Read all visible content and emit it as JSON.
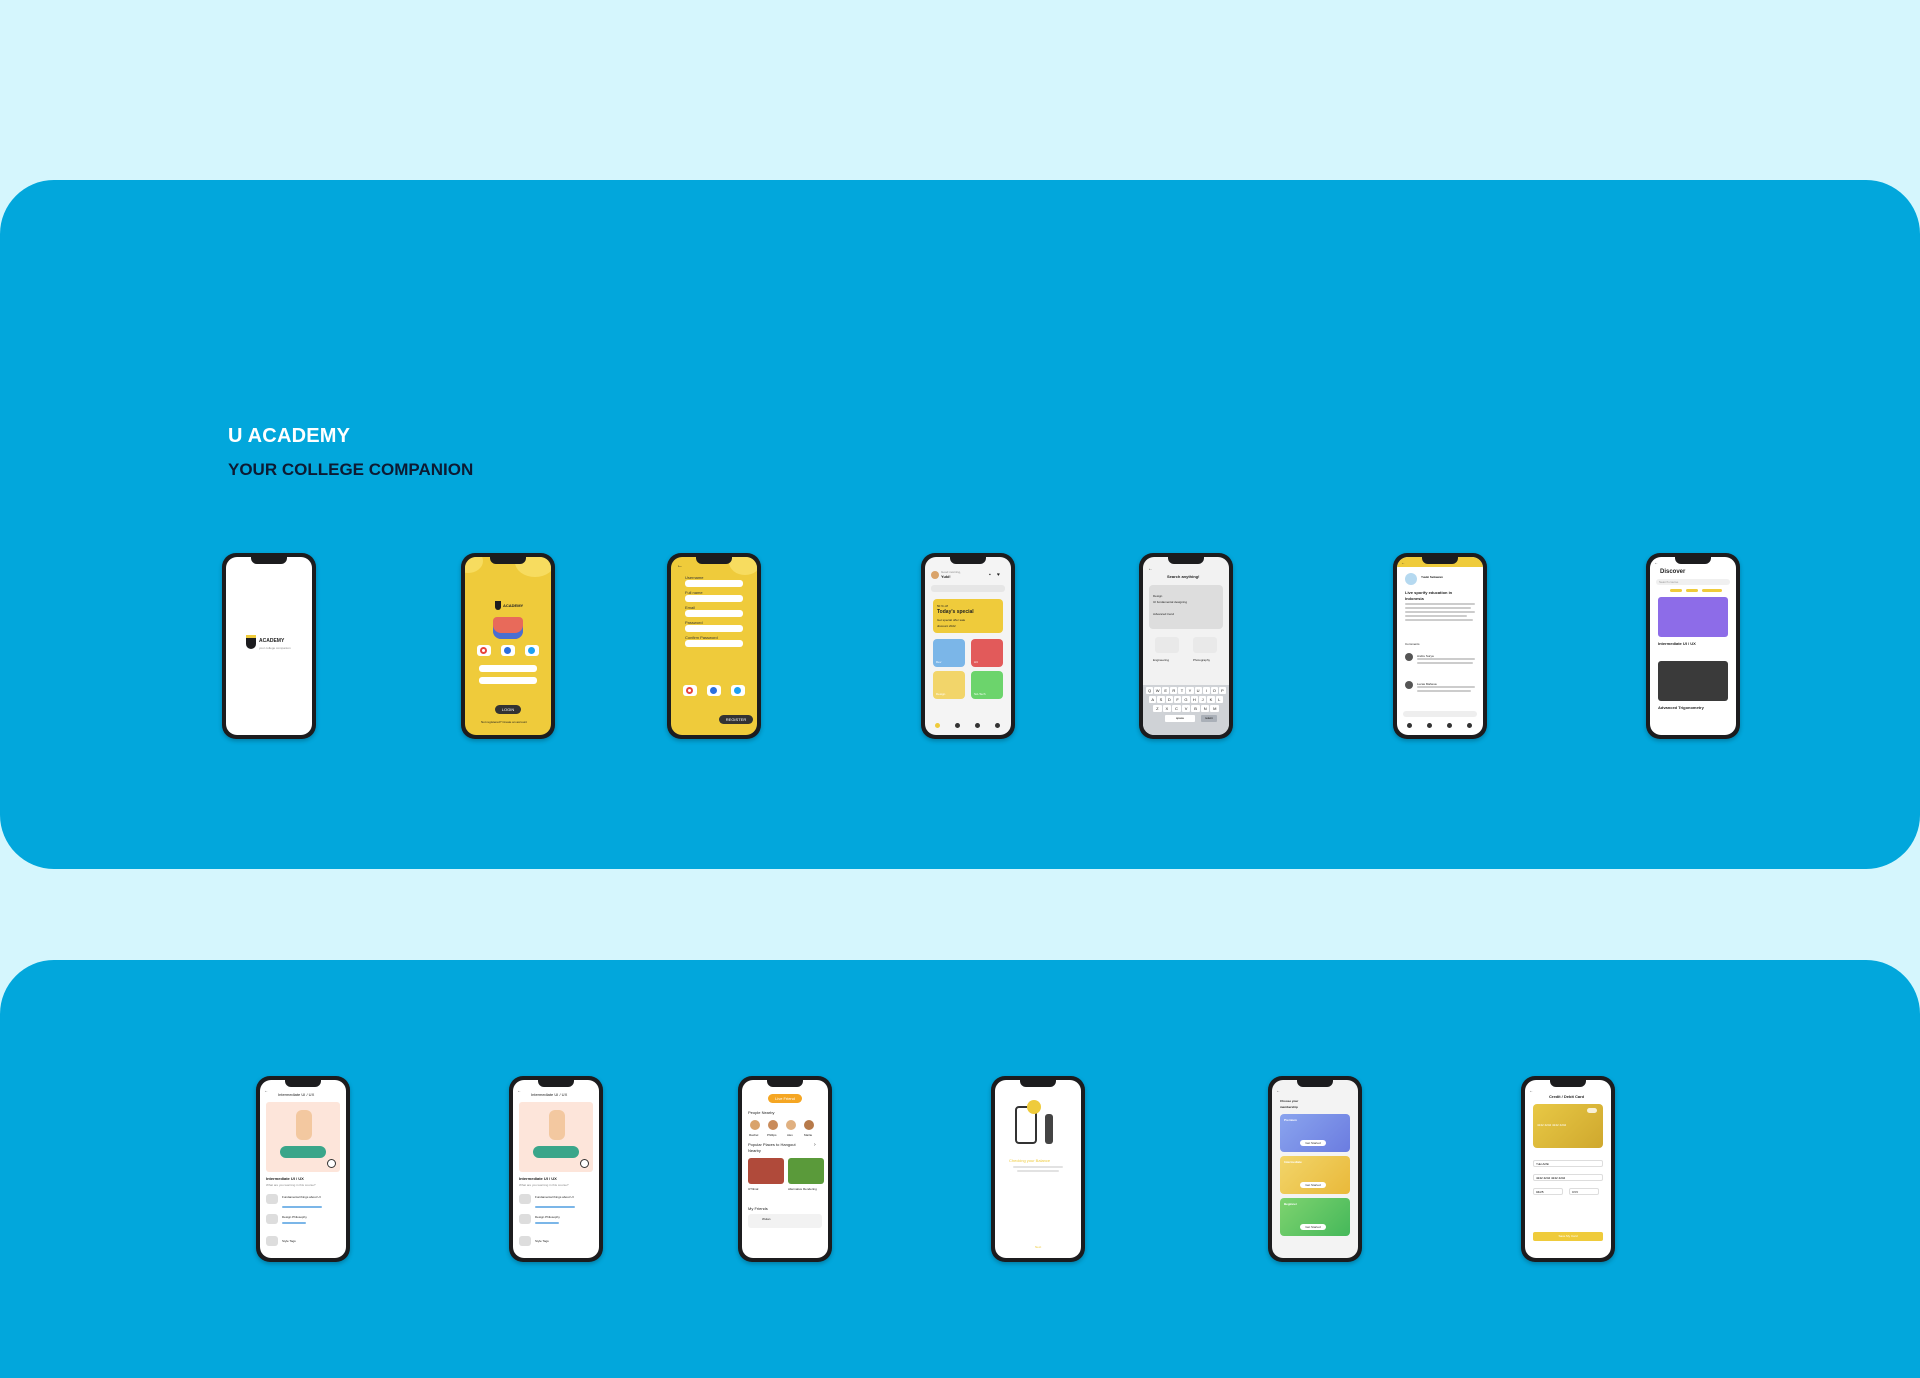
{
  "brand": {
    "title": "U ACADEMY",
    "subtitle": "YOUR COLLEGE COMPANION"
  },
  "colors": {
    "background": "#d5f6fd",
    "panel": "#02a7dc",
    "accent_yellow": "#efcb3b",
    "dark": "#1c1c1e"
  },
  "screens": {
    "splash": {
      "logo": "ACADEMY",
      "tagline": "your college companion"
    },
    "login": {
      "logo": "ACADEMY",
      "button": "LOGIN",
      "footer": "Not registered? Create an account"
    },
    "register": {
      "fields": [
        "Username",
        "Full name",
        "Email",
        "Password",
        "Confirm Password"
      ],
      "button": "REGISTER"
    },
    "home": {
      "greeting": "Good morning,",
      "user": "Yuki!",
      "promo_pct": "50 % off",
      "promo_title": "Today's special",
      "promo_sub": "Get special offer sale discount 2022",
      "categories": [
        "Dev",
        "Art",
        "Design",
        "Sci-Tech"
      ]
    },
    "search": {
      "title": "Search anything!",
      "recent": [
        "Design",
        "UI fundamental designing",
        "Advanced trend"
      ],
      "tags": [
        "Engineering",
        "Photography"
      ],
      "keyboard": [
        "QWERTYUIOP",
        "ASDFGHJKL",
        "ZXCVBNM"
      ],
      "space": "space",
      "return": "return"
    },
    "post": {
      "author": "Yuuki Setiawan",
      "post_title": "Live sporify education in Indonesia",
      "section": "Comments",
      "commenters": [
        "Andre Surya",
        "Lucas Mahesa"
      ]
    },
    "discover": {
      "title": "Discover",
      "search_placeholder": "Search course",
      "course_1": "Intermediate UI / UX",
      "course_2": "Advanced Trigonometry"
    },
    "course": {
      "title": "Intermediate UI / UX",
      "question": "What are you learning in this course?",
      "lessons": [
        "Fundamental things about UI",
        "Design Philosophy",
        "Style Tags"
      ]
    },
    "community": {
      "button": "Live Friend",
      "people_header": "People Nearby",
      "people": [
        "Rachel",
        "Phillips",
        "Alex",
        "Marlie"
      ],
      "places_header": "Popular Places to Hangout Nearby",
      "places": [
        "UTIlmal",
        "Alternative Rendering"
      ],
      "friends_header": "My Friends",
      "friend": "Wulan"
    },
    "onboarding": {
      "title": "Checking your Balance",
      "button": "Next"
    },
    "membership": {
      "title": "Choose your membership",
      "plans": [
        "Premium",
        "Intermediate",
        "Beginner"
      ],
      "plan_button": "Get Started"
    },
    "payment": {
      "title": "Credit / Debit Card",
      "card_number": "4242 4242 4242 4242",
      "name": "Yuki Arifin",
      "number": "4242 4242 4242 4242",
      "expiry": "04/25",
      "cvv": "CVV",
      "button": "Save My Card"
    }
  }
}
